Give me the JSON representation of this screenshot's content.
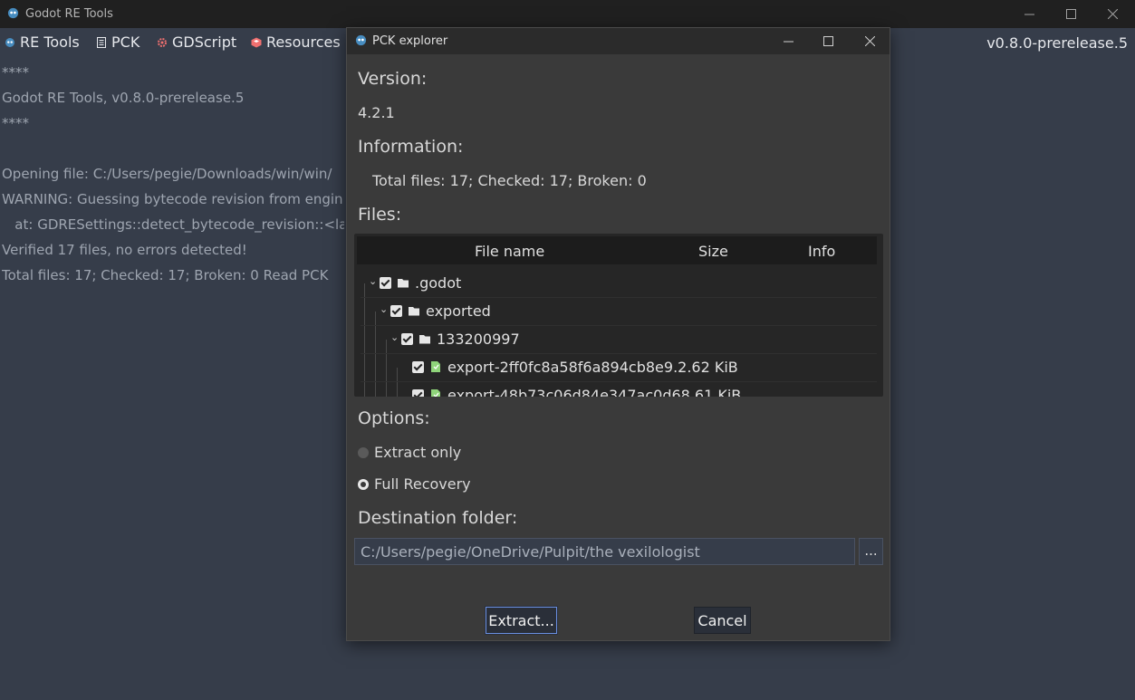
{
  "main_window": {
    "title": "Godot RE Tools",
    "menu": [
      {
        "label": "RE Tools",
        "icon": "godot-icon"
      },
      {
        "label": "PCK",
        "icon": "pck-icon"
      },
      {
        "label": "GDScript",
        "icon": "gear-icon"
      },
      {
        "label": "Resources",
        "icon": "resource-icon"
      }
    ],
    "version": "v0.8.0-prerelease.5",
    "log_lines": [
      "****",
      "Godot RE Tools, v0.8.0-prerelease.5",
      "****",
      "",
      "Opening file: C:/Users/pegie/Downloads/win/win/",
      "WARNING: Guessing bytecode revision from engin",
      "   at: GDRESettings::detect_bytecode_revision::<la",
      "Verified 17 files, no errors detected!",
      "Total files: 17; Checked: 17; Broken: 0 Read PCK"
    ]
  },
  "dialog": {
    "title": "PCK explorer",
    "version_label": "Version:",
    "version_value": "4.2.1",
    "information_label": "Information:",
    "information_value": "Total files: 17; Checked: 17; Broken: 0",
    "files_label": "Files:",
    "columns": [
      "File name",
      "Size",
      "Info"
    ],
    "tree_rows": [
      {
        "name": ".godot",
        "kind": "folder"
      },
      {
        "name": "exported",
        "kind": "folder"
      },
      {
        "name": "133200997",
        "kind": "folder"
      },
      {
        "name": "export-2ff0fc8a58f6a894cb8e9.2.62 KiB",
        "kind": "file"
      },
      {
        "name": "export-48b73c06d84e347ac0d68.61 KiB",
        "kind": "file"
      }
    ],
    "options_label": "Options:",
    "options": [
      {
        "label": "Extract only",
        "selected": false
      },
      {
        "label": "Full Recovery",
        "selected": true
      }
    ],
    "destination_label": "Destination folder:",
    "destination_value": "C:/Users/pegie/OneDrive/Pulpit/the vexilologist",
    "browse_label": "...",
    "extract_label": "Extract...",
    "cancel_label": "Cancel"
  }
}
